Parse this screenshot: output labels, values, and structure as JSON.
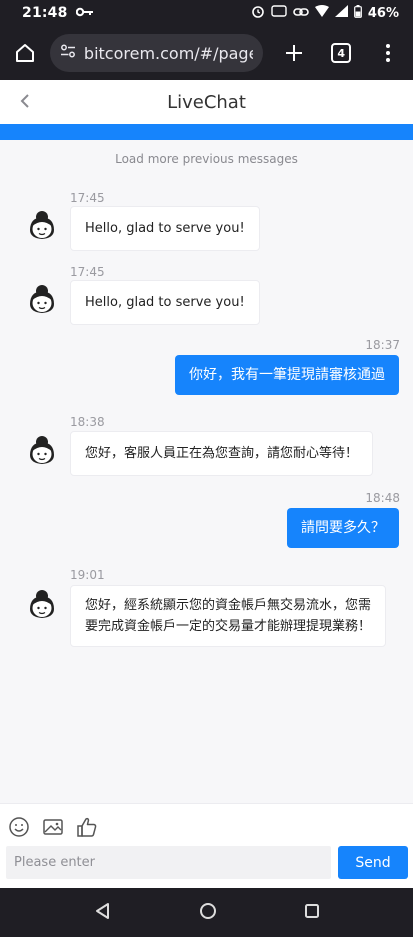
{
  "status_bar": {
    "time": "21:48",
    "battery": "46%"
  },
  "browser": {
    "url": "bitcorem.com/#/pages/l",
    "tab_count": "4"
  },
  "header": {
    "title": "LiveChat"
  },
  "chat": {
    "load_more": "Load more previous messages",
    "messages": [
      {
        "side": "agent",
        "time": "17:45",
        "text": "Hello, glad to serve you!"
      },
      {
        "side": "agent",
        "time": "17:45",
        "text": "Hello, glad to serve you!"
      },
      {
        "side": "user",
        "time": "18:37",
        "text": "你好，我有一筆提現請審核通過"
      },
      {
        "side": "agent",
        "time": "18:38",
        "text": "您好，客服人員正在為您查詢，請您耐心等待！"
      },
      {
        "side": "user",
        "time": "18:48",
        "text": "請問要多久？"
      },
      {
        "side": "agent",
        "time": "19:01",
        "text_lines": [
          "您好，經系統顯示您的資金帳戶無交易流水，您需",
          "要完成資金帳戶一定的交易量才能辦理提現業務！"
        ]
      }
    ]
  },
  "composer": {
    "placeholder": "Please enter",
    "send_label": "Send"
  },
  "colors": {
    "accent": "#1684fc",
    "page_bg": "#f7f7f9",
    "bubble_bg": "#ffffff"
  }
}
